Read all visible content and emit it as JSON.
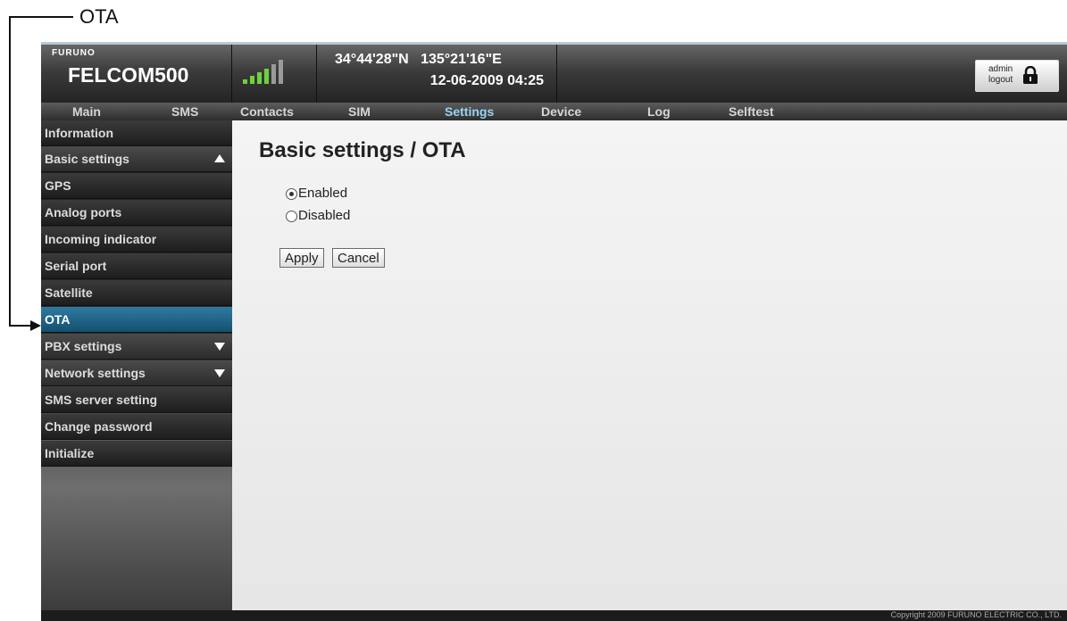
{
  "callout": {
    "label": "OTA"
  },
  "header": {
    "brand_small": "FURUNO",
    "brand": "FELCOM500",
    "latitude": "34°44'28\"N",
    "longitude": "135°21'16\"E",
    "datetime": "12-06-2009 04:25",
    "user": "admin",
    "logout_label": "logout",
    "signal_bars_active": 4,
    "signal_bars_total": 6
  },
  "nav": {
    "items": [
      {
        "label": "Main"
      },
      {
        "label": "SMS"
      },
      {
        "label": "Contacts"
      },
      {
        "label": "SIM"
      },
      {
        "label": "Settings"
      },
      {
        "label": "Device"
      },
      {
        "label": "Log"
      },
      {
        "label": "Selftest"
      }
    ],
    "active": "Settings"
  },
  "sidebar": {
    "items": [
      {
        "label": "Information"
      },
      {
        "label": "Basic settings"
      },
      {
        "label": "GPS"
      },
      {
        "label": "Analog ports"
      },
      {
        "label": "Incoming indicator"
      },
      {
        "label": "Serial port"
      },
      {
        "label": "Satellite"
      },
      {
        "label": "OTA"
      },
      {
        "label": "PBX settings"
      },
      {
        "label": "Network settings"
      },
      {
        "label": "SMS server setting"
      },
      {
        "label": "Change password"
      },
      {
        "label": "Initialize"
      }
    ],
    "active": "OTA"
  },
  "main": {
    "title": "Basic settings / OTA",
    "options": [
      {
        "label": "Enabled",
        "selected": true
      },
      {
        "label": "Disabled",
        "selected": false
      }
    ],
    "apply_label": "Apply",
    "cancel_label": "Cancel"
  },
  "footer": {
    "copyright": "Copyright 2009 FURUNO ELECTRIC CO., LTD."
  },
  "colors": {
    "accent": "#9bd3f3",
    "active_sidebar": "#1f6a92",
    "signal": "#6fd13e"
  }
}
